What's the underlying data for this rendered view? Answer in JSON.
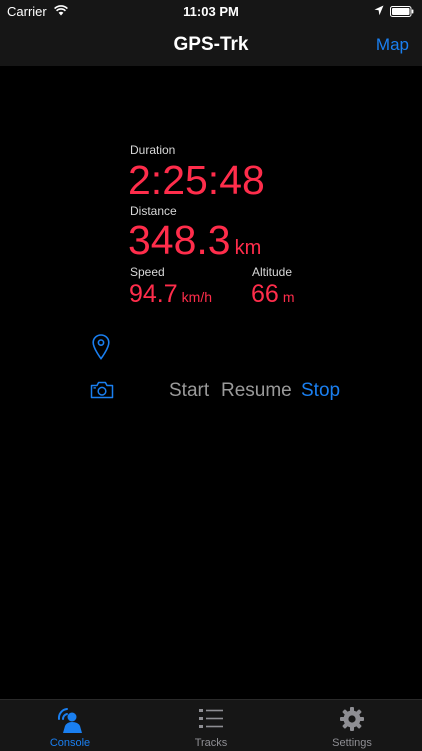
{
  "status_bar": {
    "carrier": "Carrier",
    "time": "11:03 PM"
  },
  "nav": {
    "title": "GPS-Trk",
    "map_button": "Map"
  },
  "stats": {
    "duration": {
      "label": "Duration",
      "value": "2:25:48"
    },
    "distance": {
      "label": "Distance",
      "value": "348.3",
      "unit": "km"
    },
    "speed": {
      "label": "Speed",
      "value": "94.7",
      "unit": "km/h"
    },
    "altitude": {
      "label": "Altitude",
      "value": "66",
      "unit": "m"
    }
  },
  "controls": {
    "start": "Start",
    "resume": "Resume",
    "stop": "Stop"
  },
  "tabs": [
    {
      "label": "Console",
      "icon": "console-icon",
      "active": true
    },
    {
      "label": "Tracks",
      "icon": "list-icon",
      "active": false
    },
    {
      "label": "Settings",
      "icon": "gear-icon",
      "active": false
    }
  ],
  "colors": {
    "accent": "#1a7ff0",
    "value": "#ff2d4b",
    "inactive": "#8e8e93",
    "disabled": "#9a9a9a",
    "background": "#000000",
    "bar": "#161616"
  }
}
